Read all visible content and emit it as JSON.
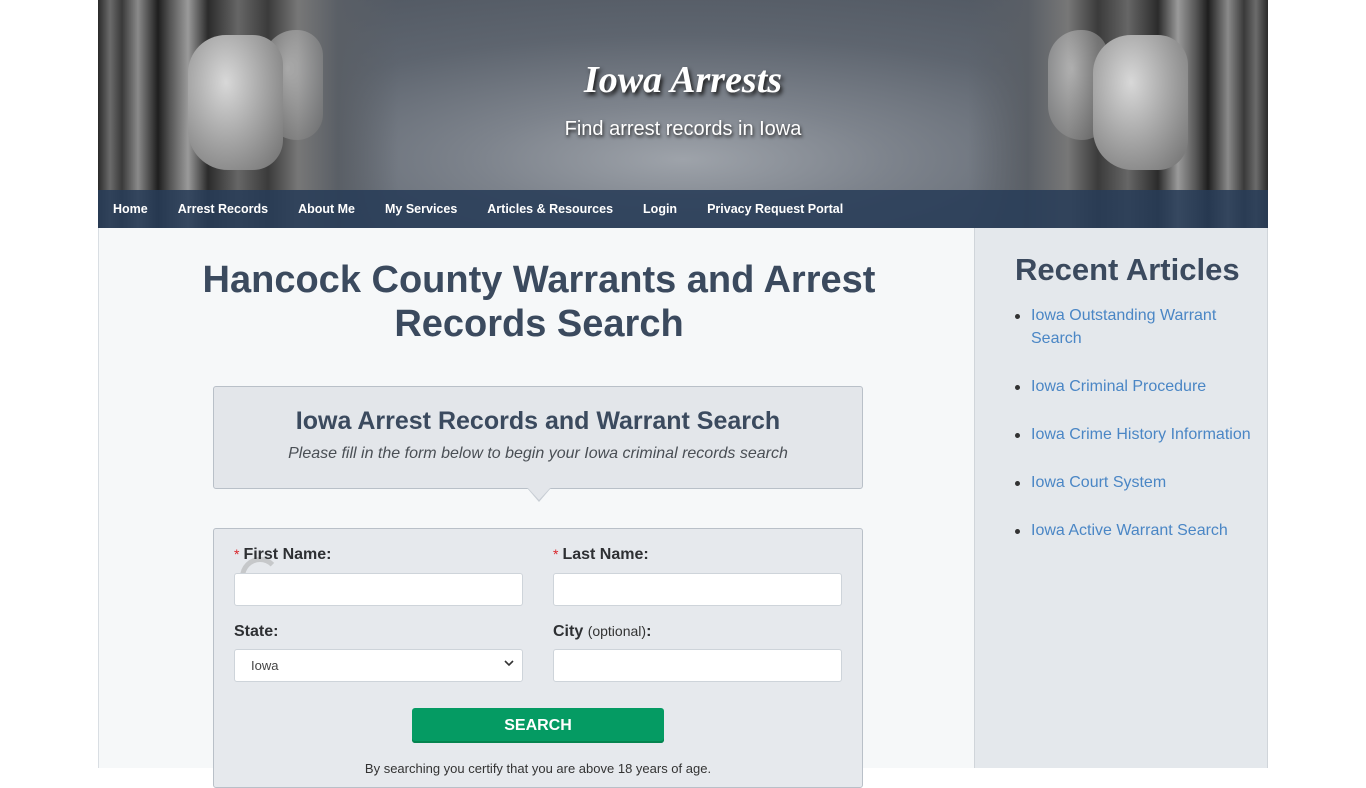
{
  "header": {
    "site_title": "Iowa Arrests",
    "tagline": "Find arrest records in Iowa"
  },
  "nav": {
    "items": [
      {
        "label": "Home"
      },
      {
        "label": "Arrest Records"
      },
      {
        "label": "About Me"
      },
      {
        "label": "My Services"
      },
      {
        "label": "Articles & Resources"
      },
      {
        "label": "Login"
      },
      {
        "label": "Privacy Request Portal"
      }
    ]
  },
  "main": {
    "page_title": "Hancock County Warrants and Arrest Records Search",
    "intro": {
      "title": "Iowa Arrest Records and Warrant Search",
      "subtitle": "Please fill in the form below to begin your Iowa criminal records search"
    },
    "form": {
      "required_marker": "*",
      "first_name_label": "First Name:",
      "first_name_value": "",
      "last_name_label": "Last Name:",
      "last_name_value": "",
      "state_label": "State:",
      "state_value": "Iowa",
      "city_label": "City",
      "city_optional": "(optional)",
      "city_colon": ":",
      "city_value": "",
      "search_label": "SEARCH",
      "disclaimer": "By searching you certify that you are above 18 years of age."
    }
  },
  "sidebar": {
    "title": "Recent Articles",
    "articles": [
      {
        "label": "Iowa Outstanding Warrant Search"
      },
      {
        "label": "Iowa Criminal Procedure"
      },
      {
        "label": "Iowa Crime History Information"
      },
      {
        "label": "Iowa Court System"
      },
      {
        "label": "Iowa Active Warrant Search"
      }
    ]
  },
  "colors": {
    "nav_bg": "#2c3e58",
    "heading": "#3b4a5e",
    "link": "#4a86c5",
    "search_button": "#059b63",
    "required": "#d9252a"
  }
}
